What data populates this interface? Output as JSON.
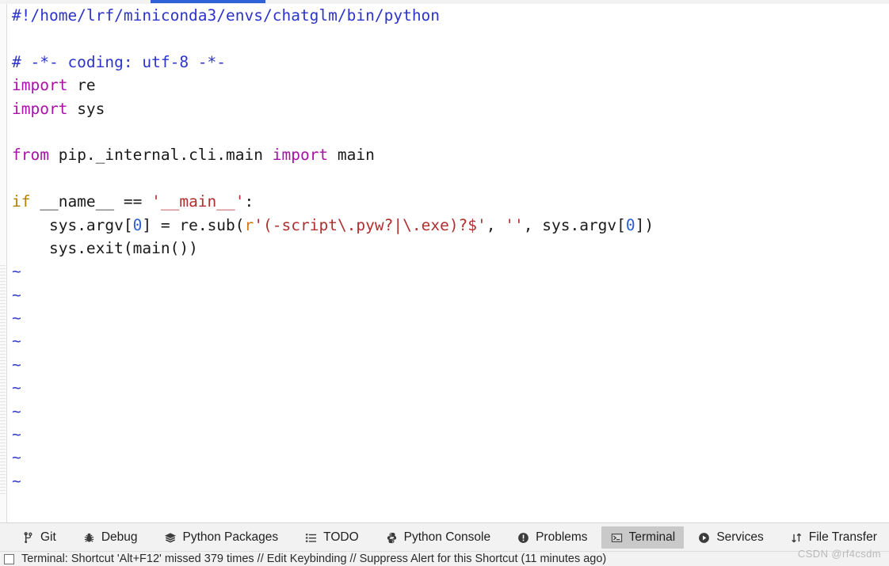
{
  "editor": {
    "language": "python",
    "lines": [
      {
        "indent": 0,
        "tokens": [
          {
            "t": "comment",
            "s": "#!/home/lrf/miniconda3/envs/chatglm/bin/python"
          }
        ]
      },
      {
        "indent": 0,
        "tokens": []
      },
      {
        "indent": 0,
        "tokens": [
          {
            "t": "comment",
            "s": "# -*- coding: utf-8 -*-"
          }
        ]
      },
      {
        "indent": 0,
        "tokens": [
          {
            "t": "keyword",
            "s": "import"
          },
          {
            "t": "plain",
            "s": " re"
          }
        ]
      },
      {
        "indent": 0,
        "tokens": [
          {
            "t": "keyword",
            "s": "import"
          },
          {
            "t": "plain",
            "s": " sys"
          }
        ]
      },
      {
        "indent": 0,
        "tokens": []
      },
      {
        "indent": 0,
        "tokens": [
          {
            "t": "keyword",
            "s": "from"
          },
          {
            "t": "plain",
            "s": " pip._internal.cli.main "
          },
          {
            "t": "keyword",
            "s": "import"
          },
          {
            "t": "plain",
            "s": " main"
          }
        ]
      },
      {
        "indent": 0,
        "tokens": []
      },
      {
        "indent": 0,
        "tokens": [
          {
            "t": "kw2",
            "s": "if"
          },
          {
            "t": "plain",
            "s": " __name__ == "
          },
          {
            "t": "string",
            "s": "'__main__'"
          },
          {
            "t": "plain",
            "s": ":"
          }
        ]
      },
      {
        "indent": 1,
        "tokens": [
          {
            "t": "plain",
            "s": "sys.argv["
          },
          {
            "t": "number",
            "s": "0"
          },
          {
            "t": "plain",
            "s": "] = re.sub("
          },
          {
            "t": "prefix",
            "s": "r"
          },
          {
            "t": "string",
            "s": "'(-script\\.pyw?|\\.exe)?$'"
          },
          {
            "t": "plain",
            "s": ", "
          },
          {
            "t": "string",
            "s": "''"
          },
          {
            "t": "plain",
            "s": ", sys.argv["
          },
          {
            "t": "number",
            "s": "0"
          },
          {
            "t": "plain",
            "s": "])"
          }
        ]
      },
      {
        "indent": 1,
        "tokens": [
          {
            "t": "plain",
            "s": "sys.exit(main())"
          }
        ]
      }
    ],
    "empty_line_markers": [
      "~",
      "~",
      "~",
      "~",
      "~",
      "~",
      "~",
      "~",
      "~",
      "~"
    ],
    "empty_line_marker_char": "~"
  },
  "tool_window_bar": {
    "tabs": [
      {
        "label": "Git",
        "icon": "git-branch-icon",
        "active": false,
        "gap_after": "md"
      },
      {
        "label": "Debug",
        "icon": "bug-icon",
        "active": false,
        "gap_after": "md"
      },
      {
        "label": "Python Packages",
        "icon": "layers-icon",
        "active": false,
        "gap_after": "md"
      },
      {
        "label": "TODO",
        "icon": "checklist-icon",
        "active": false,
        "gap_after": "md"
      },
      {
        "label": "Python Console",
        "icon": "python-icon",
        "active": false,
        "gap_after": "md"
      },
      {
        "label": "Problems",
        "icon": "exclamation-circle-icon",
        "active": false,
        "gap_after": "sm"
      },
      {
        "label": "Terminal",
        "icon": "terminal-icon",
        "active": true,
        "gap_after": "sm"
      },
      {
        "label": "Services",
        "icon": "play-circle-icon",
        "active": false,
        "gap_after": "md"
      },
      {
        "label": "File Transfer",
        "icon": "transfer-arrows-icon",
        "active": false,
        "gap_after": "sm"
      }
    ]
  },
  "status_bar": {
    "message": "Terminal: Shortcut 'Alt+F12' missed 379 times // Edit Keybinding // Suppress Alert for this Shortcut (11 minutes ago)"
  },
  "watermark": {
    "text": "CSDN @rf4csdm"
  },
  "colors": {
    "comment": "#2d34cc",
    "keyword": "#a811a8",
    "control_keyword": "#b08000",
    "string": "#b03030",
    "number": "#2c5fd0",
    "string_prefix": "#c97b1c",
    "tilde_marker": "#3a41c9",
    "tab_accent": "#2f62d6",
    "active_tab_bg": "#c9c9c9",
    "toolbar_bg": "#f2f2f2",
    "editor_bg": "#ffffff"
  }
}
